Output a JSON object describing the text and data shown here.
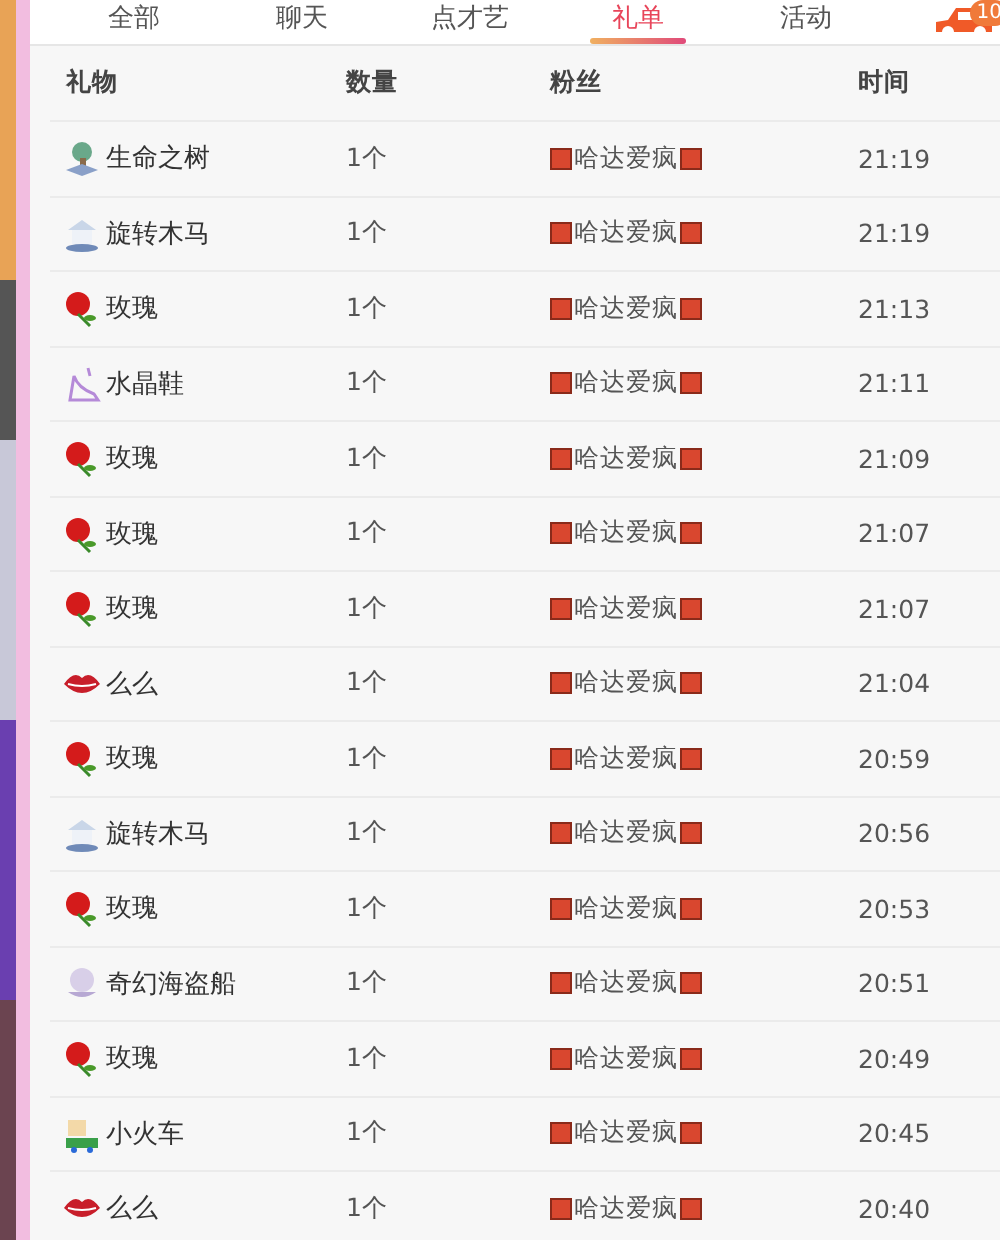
{
  "tabs": [
    {
      "label": "全部",
      "selected": false
    },
    {
      "label": "聊天",
      "selected": false
    },
    {
      "label": "点才艺",
      "selected": false
    },
    {
      "label": "礼单",
      "selected": true
    },
    {
      "label": "活动",
      "selected": false
    }
  ],
  "car_badge": "10",
  "table": {
    "columns": [
      "礼物",
      "数量",
      "粉丝",
      "时间"
    ],
    "rows": [
      {
        "gift": "生命之树",
        "kind": "tree",
        "count": "1个",
        "fan": "哈达爱疯",
        "time": "21:19"
      },
      {
        "gift": "旋转木马",
        "kind": "carousel",
        "count": "1个",
        "fan": "哈达爱疯",
        "time": "21:19"
      },
      {
        "gift": "玫瑰",
        "kind": "rose",
        "count": "1个",
        "fan": "哈达爱疯",
        "time": "21:13"
      },
      {
        "gift": "水晶鞋",
        "kind": "shoe",
        "count": "1个",
        "fan": "哈达爱疯",
        "time": "21:11"
      },
      {
        "gift": "玫瑰",
        "kind": "rose",
        "count": "1个",
        "fan": "哈达爱疯",
        "time": "21:09"
      },
      {
        "gift": "玫瑰",
        "kind": "rose",
        "count": "1个",
        "fan": "哈达爱疯",
        "time": "21:07"
      },
      {
        "gift": "玫瑰",
        "kind": "rose",
        "count": "1个",
        "fan": "哈达爱疯",
        "time": "21:07"
      },
      {
        "gift": "么么",
        "kind": "lips",
        "count": "1个",
        "fan": "哈达爱疯",
        "time": "21:04"
      },
      {
        "gift": "玫瑰",
        "kind": "rose",
        "count": "1个",
        "fan": "哈达爱疯",
        "time": "20:59"
      },
      {
        "gift": "旋转木马",
        "kind": "carousel",
        "count": "1个",
        "fan": "哈达爱疯",
        "time": "20:56"
      },
      {
        "gift": "玫瑰",
        "kind": "rose",
        "count": "1个",
        "fan": "哈达爱疯",
        "time": "20:53"
      },
      {
        "gift": "奇幻海盗船",
        "kind": "ship",
        "count": "1个",
        "fan": "哈达爱疯",
        "time": "20:51"
      },
      {
        "gift": "玫瑰",
        "kind": "rose",
        "count": "1个",
        "fan": "哈达爱疯",
        "time": "20:49"
      },
      {
        "gift": "小火车",
        "kind": "train",
        "count": "1个",
        "fan": "哈达爱疯",
        "time": "20:45"
      },
      {
        "gift": "么么",
        "kind": "lips",
        "count": "1个",
        "fan": "哈达爱疯",
        "time": "20:40"
      }
    ]
  }
}
